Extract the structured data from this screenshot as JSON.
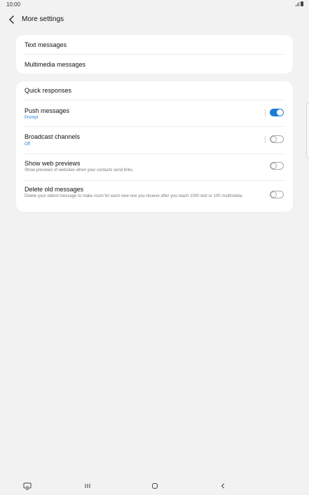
{
  "status_bar": {
    "time": "10:00",
    "icons": [
      "signal-icon",
      "battery-icon"
    ]
  },
  "header": {
    "title": "More settings",
    "back_icon": "chevron-left-icon"
  },
  "card1": {
    "items": [
      {
        "label": "Text messages"
      },
      {
        "label": "Multimedia messages"
      }
    ]
  },
  "card2": {
    "quick_responses": {
      "label": "Quick responses"
    },
    "push_messages": {
      "label": "Push messages",
      "sub": "Prompt",
      "toggle_on": true
    },
    "broadcast_channels": {
      "label": "Broadcast channels",
      "sub": "Off",
      "toggle_on": false
    },
    "web_previews": {
      "label": "Show web previews",
      "sub": "Show previews of websites when your contacts send links.",
      "toggle_on": false
    },
    "delete_old": {
      "label": "Delete old messages",
      "sub": "Delete your oldest message to make room for each new one you receive after you reach 1000 text or 100 multimedia.",
      "toggle_on": false
    }
  },
  "colors": {
    "accent": "#1a7cd6",
    "background": "#f2f2f2",
    "card": "#ffffff"
  },
  "nav_bar": {
    "icons": [
      "keyboard-icon",
      "recent-apps-icon",
      "home-icon",
      "back-icon"
    ]
  }
}
